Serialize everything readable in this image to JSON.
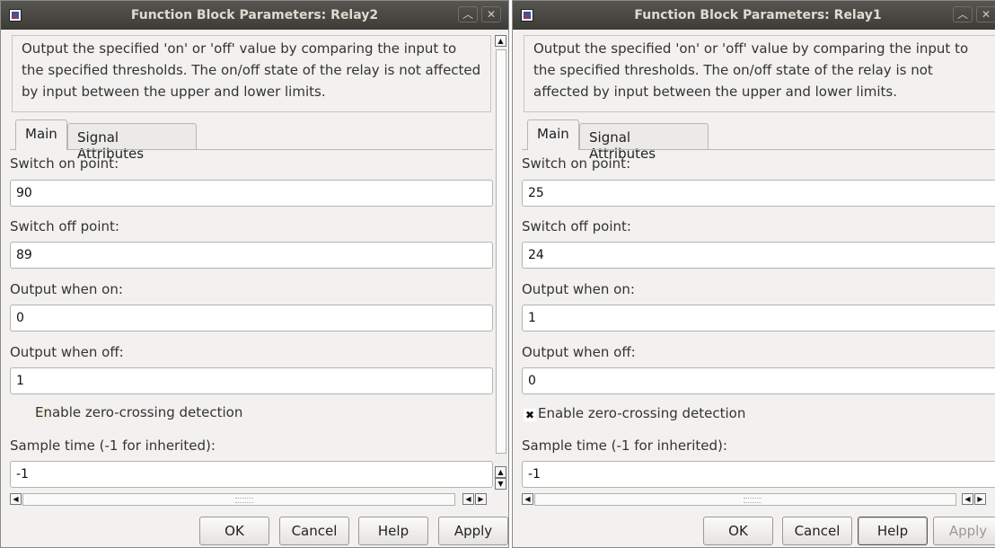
{
  "dialogs": [
    {
      "title": "Function Block Parameters: Relay2",
      "description": "Output the specified 'on' or 'off' value by comparing the input to the specified thresholds.  The on/off state of the relay is not affected by input between the upper and lower limits.",
      "tabs": [
        "Main",
        "Signal Attributes"
      ],
      "fields": {
        "switch_on_label": "Switch on point:",
        "switch_on_value": "90",
        "switch_off_label": "Switch off point:",
        "switch_off_value": "89",
        "output_on_label": "Output when on:",
        "output_on_value": "0",
        "output_off_label": "Output when off:",
        "output_off_value": "1",
        "zero_crossing_label": "Enable zero-crossing detection",
        "zero_crossing_checked": false,
        "sample_time_label": "Sample time (-1 for inherited):",
        "sample_time_value": "-1"
      },
      "buttons": {
        "ok": "OK",
        "cancel": "Cancel",
        "help": "Help",
        "apply": "Apply"
      }
    },
    {
      "title": "Function Block Parameters: Relay1",
      "description": "Output the specified 'on' or 'off' value by comparing the input to the specified thresholds.  The on/off state of the relay is not affected by input between the upper and lower limits.",
      "tabs": [
        "Main",
        "Signal Attributes"
      ],
      "fields": {
        "switch_on_label": "Switch on point:",
        "switch_on_value": "25",
        "switch_off_label": "Switch off point:",
        "switch_off_value": "24",
        "output_on_label": "Output when on:",
        "output_on_value": "1",
        "output_off_label": "Output when off:",
        "output_off_value": "0",
        "zero_crossing_label": "Enable zero-crossing detection",
        "zero_crossing_checked": true,
        "sample_time_label": "Sample time (-1 for inherited):",
        "sample_time_value": "-1"
      },
      "buttons": {
        "ok": "OK",
        "cancel": "Cancel",
        "help": "Help",
        "apply": "Apply"
      }
    }
  ],
  "icons": {
    "app": "simulink-block-icon",
    "maximize": "chevron-up-icon",
    "close": "close-icon",
    "checkmark": "✖"
  },
  "colors": {
    "titlebar": "#3d3c37",
    "window_bg": "#f2f1f0",
    "title_text": "#dfdbd2"
  }
}
